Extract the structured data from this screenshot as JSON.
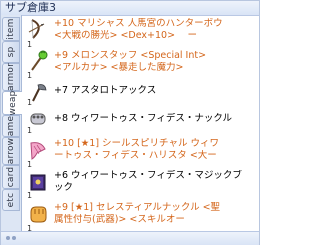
{
  "window": {
    "title": "サブ倉庫3"
  },
  "tabs": [
    "item",
    "sp",
    "armor",
    "weapon",
    "ammo",
    "card",
    "arrow",
    "etc",
    "all"
  ],
  "tab_labels": {
    "item": "item",
    "sp": "sp",
    "armor": "armor",
    "weapon": "weap",
    "ammo": "ame",
    "arrow": "arrow",
    "card": "card",
    "etc": "etc",
    "all": "all"
  },
  "items": [
    {
      "count": "1",
      "name_line1": "+10 マリシャス 人馬宮のハンターボウ",
      "name_line2": "<大戦の勝光> <Dex+10> 　ー",
      "color": "#d4661b",
      "icon": "bow-icon"
    },
    {
      "count": "1",
      "name_line1": "+9 メロンスタッフ <Special Int>",
      "name_line2": "<アルカナ> <暴走した魔力>",
      "color": "#d4661b",
      "icon": "staff-icon"
    },
    {
      "count": "1",
      "name_line1": "+7 アスタロトアックス",
      "name_line2": "",
      "color": "#000000",
      "icon": "axe-icon"
    },
    {
      "count": "1",
      "name_line1": "+8 ウィワートゥス・フィデス・ナックル",
      "name_line2": "",
      "color": "#000000",
      "icon": "knuckle-icon"
    },
    {
      "count": "1",
      "name_line1": "+10 [★1] シールスピリチャル ウィワ",
      "name_line2": "ートゥス・フィデス・ハリスタ <大ー",
      "color": "#d4661b",
      "icon": "instrument-icon"
    },
    {
      "count": "1",
      "name_line1": "+6 ウィワートゥス・フィデス・マジックブ",
      "name_line2": "ック",
      "color": "#000000",
      "icon": "book-icon"
    },
    {
      "count": "1",
      "name_line1": "+9 [★1] セレスティアルナックル <聖",
      "name_line2": "属性付与(武器)> <スキルオー",
      "color": "#d4661b",
      "icon": "gauntlet-icon"
    }
  ],
  "colors": {
    "orange": "#d4661b",
    "black": "#000000",
    "accent": "#b8c6df"
  }
}
